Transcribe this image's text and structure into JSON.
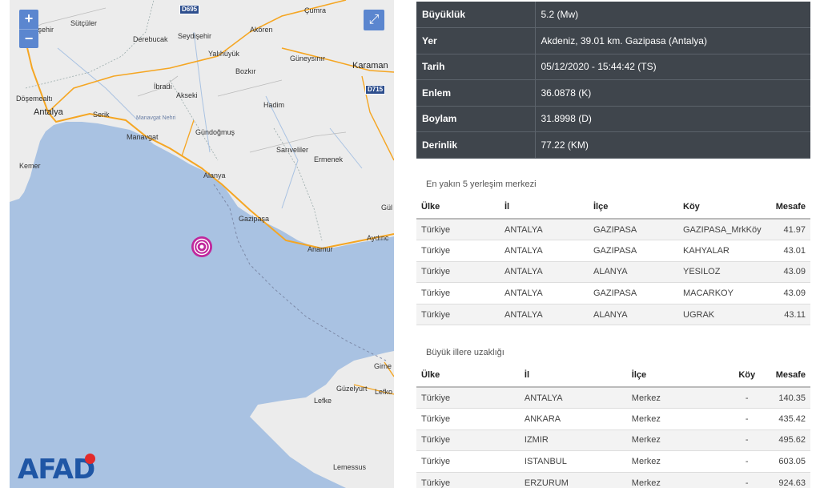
{
  "map": {
    "zoom_in": "+",
    "zoom_out": "−",
    "fullscreen": "⤢",
    "logo": "AFAD",
    "roads": [
      "D695",
      "D715"
    ],
    "places": [
      "Çumra",
      "Beyşehir",
      "Sütçüler",
      "Derebucak",
      "Seydişehir",
      "Akören",
      "Yalıhüyük",
      "Güneysınır",
      "Karaman",
      "Bozkır",
      "İbradı",
      "Akseki",
      "Hadim",
      "Döşemealtı",
      "Antalya",
      "Serik",
      "Manavgat Nehri",
      "Manavgat",
      "Gündoğmuş",
      "Sarıveliler",
      "Ermenek",
      "Kemer",
      "Alanya",
      "Gazipaşa",
      "Gül",
      "Anamur",
      "Aydınc",
      "Girne",
      "Güzelyurt",
      "Lefke",
      "Lefko",
      "Lemessus"
    ],
    "colors": {
      "sea": "#a9c2e2",
      "land": "#ececec",
      "road": "#f5a623",
      "epicenter": "#c0279c"
    }
  },
  "details": [
    {
      "label": "Büyüklük",
      "value": "5.2 (Mw)"
    },
    {
      "label": "Yer",
      "value": "Akdeniz, 39.01 km. Gazipasa (Antalya)"
    },
    {
      "label": "Tarih",
      "value": "05/12/2020 - 15:44:42 (TS)"
    },
    {
      "label": "Enlem",
      "value": "36.0878 (K)"
    },
    {
      "label": "Boylam",
      "value": "31.8998 (D)"
    },
    {
      "label": "Derinlik",
      "value": "77.22 (KM)"
    }
  ],
  "nearest": {
    "title": "En yakın 5 yerleşim merkezi",
    "headers": [
      "Ülke",
      "İl",
      "İlçe",
      "Köy",
      "Mesafe"
    ],
    "rows": [
      [
        "Türkiye",
        "ANTALYA",
        "GAZIPASA",
        "GAZIPASA_MrkKöy",
        "41.97"
      ],
      [
        "Türkiye",
        "ANTALYA",
        "GAZIPASA",
        "KAHYALAR",
        "43.01"
      ],
      [
        "Türkiye",
        "ANTALYA",
        "ALANYA",
        "YESILOZ",
        "43.09"
      ],
      [
        "Türkiye",
        "ANTALYA",
        "GAZIPASA",
        "MACARKOY",
        "43.09"
      ],
      [
        "Türkiye",
        "ANTALYA",
        "ALANYA",
        "UGRAK",
        "43.11"
      ]
    ]
  },
  "cities": {
    "title": "Büyük illere uzaklığı",
    "headers": [
      "Ülke",
      "İl",
      "İlçe",
      "Köy",
      "Mesafe"
    ],
    "rows": [
      [
        "Türkiye",
        "ANTALYA",
        "Merkez",
        "-",
        "140.35"
      ],
      [
        "Türkiye",
        "ANKARA",
        "Merkez",
        "-",
        "435.42"
      ],
      [
        "Türkiye",
        "IZMIR",
        "Merkez",
        "-",
        "495.62"
      ],
      [
        "Türkiye",
        "ISTANBUL",
        "Merkez",
        "-",
        "603.05"
      ],
      [
        "Türkiye",
        "ERZURUM",
        "Merkez",
        "-",
        "924.63"
      ]
    ]
  }
}
